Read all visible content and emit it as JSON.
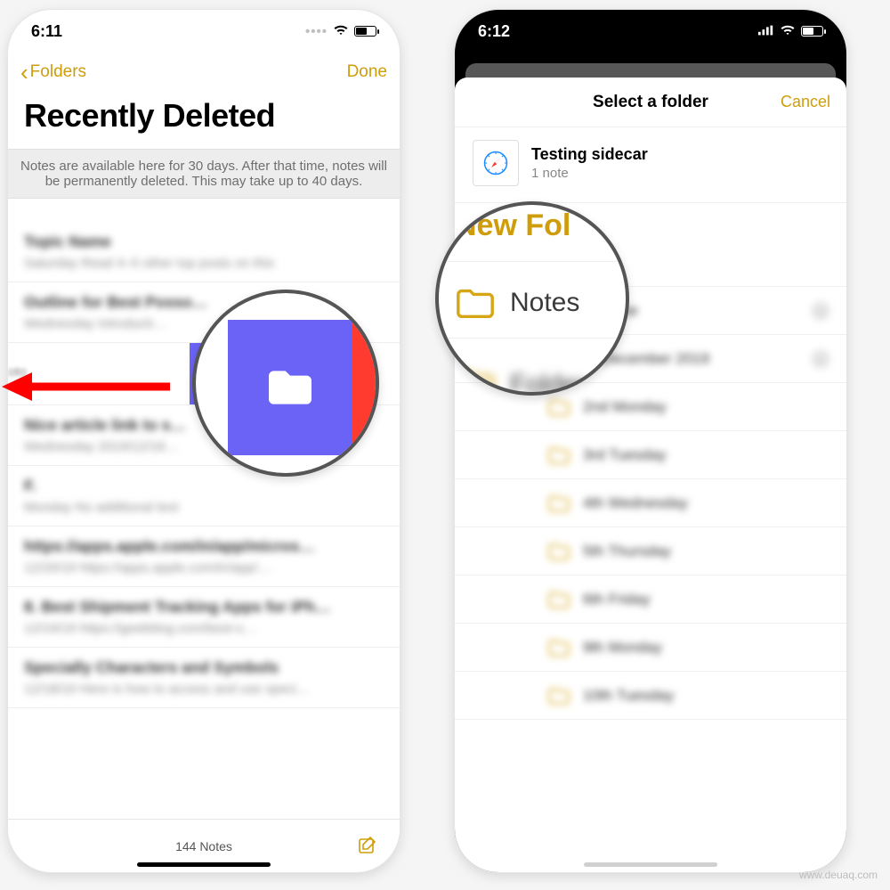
{
  "left_phone": {
    "status_time": "6:11",
    "nav_back": "Folders",
    "nav_done": "Done",
    "page_title": "Recently Deleted",
    "banner_text": "Notes are available here for 30 days. After that time, notes will be permanently deleted. This may take up to 40 days.",
    "notes_count": "144 Notes",
    "rows": [
      {
        "title": "Topic Name",
        "subtitle": "Saturday   Read 4–5 other top posts on this"
      },
      {
        "title": "Outline for Best Posso…",
        "subtitle": "Wednesday   Introducti…"
      },
      {
        "swiped": true,
        "fragment": "oto"
      },
      {
        "title": "Nice article link to s…",
        "subtitle": "Wednesday   2019/12/18…"
      },
      {
        "title": "F.",
        "subtitle": "Monday   No additional text"
      },
      {
        "title": "https://apps.apple.com/in/app/micros…",
        "subtitle": "12/20/19   https://apps.apple.com/in/app/…"
      },
      {
        "title": "8. Best Shipment Tracking Apps for iPh…",
        "subtitle": "12/19/19   https://geekblog.com/best-s…"
      },
      {
        "title": "Specially Characters and Symbols",
        "subtitle": "12/18/19   Here is how to access and use speci…"
      }
    ]
  },
  "right_phone": {
    "status_time": "6:12",
    "sheet_title": "Select a folder",
    "cancel_label": "Cancel",
    "note_title": "Testing sidecar",
    "note_count": "1 note",
    "folders": [
      {
        "name": "Notes",
        "indent": 0
      },
      {
        "name": "Ankur Overtime",
        "indent": 1,
        "disclosure": true
      },
      {
        "name": "Ankur December 2019",
        "indent": 2,
        "disclosure": true
      },
      {
        "name": "2nd Monday",
        "indent": 3
      },
      {
        "name": "3rd Tuesday",
        "indent": 3
      },
      {
        "name": "4th Wednesday",
        "indent": 3
      },
      {
        "name": "5th Thursday",
        "indent": 3
      },
      {
        "name": "6th Friday",
        "indent": 3
      },
      {
        "name": "9th Monday",
        "indent": 3
      },
      {
        "name": "10th Tuesday",
        "indent": 3
      }
    ],
    "new_folder_label": "New Fol"
  },
  "watermark": "www.deuaq.com"
}
